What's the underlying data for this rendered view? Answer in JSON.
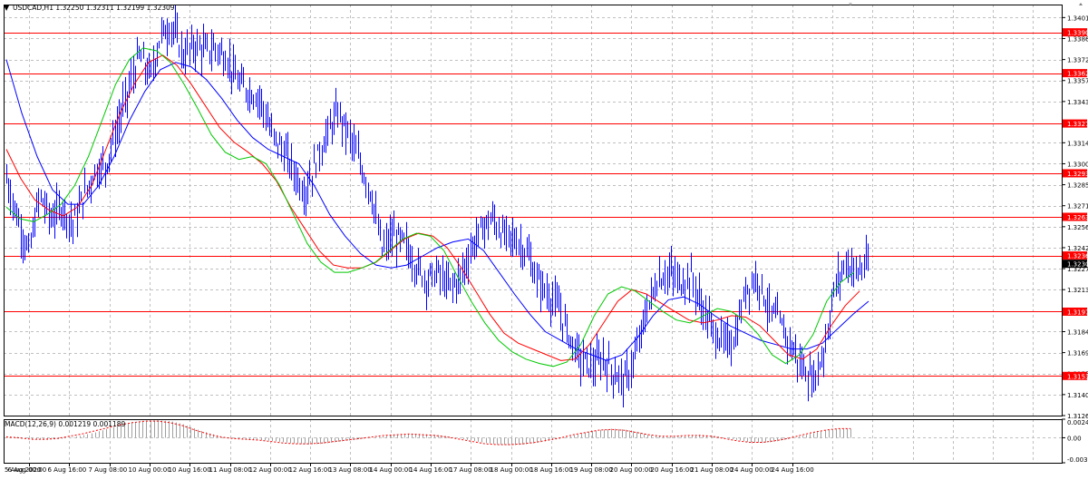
{
  "header": {
    "symbol_line": "USDCAD,H1  1.32250 1.32311 1.32199 1.32309"
  },
  "macd_label": "MACD(12,26,9) 0.001219 0.001189",
  "colors": {
    "background": "#ffffff",
    "candle": "#0000ff",
    "grid": "#c0c0c0",
    "frame": "#000000",
    "ma_fast": "#00c800",
    "ma_mid": "#ff0000",
    "ma_slow": "#0000ff",
    "hline": "#ff0000",
    "price_tag_bg": "#ff0000",
    "current_tag_bg": "#000000",
    "macd_hist": "#a0a0a0",
    "macd_signal": "#ff0000"
  },
  "chart_data": {
    "type": "line",
    "title": "USDCAD,H1",
    "price_axis_ticks": [
      "1.34010",
      "1.33865",
      "1.33720",
      "1.33575",
      "1.33430",
      "1.33145",
      "1.33000",
      "1.32855",
      "1.32710",
      "1.32565",
      "1.32420",
      "1.32275",
      "1.32130",
      "1.31840",
      "1.31695",
      "1.31550",
      "1.31405",
      "1.31260"
    ],
    "price_axis_tick_values": [
      1.3401,
      1.33865,
      1.3372,
      1.33575,
      1.3343,
      1.33145,
      1.33,
      1.32855,
      1.3271,
      1.32565,
      1.3242,
      1.32275,
      1.3213,
      1.3184,
      1.31695,
      1.3155,
      1.31405,
      1.3126
    ],
    "ylim": [
      1.3126,
      1.341
    ],
    "time_labels": [
      "5 Aug 2020",
      "6 Aug 00:00",
      "6 Aug 16:00",
      "7 Aug 08:00",
      "10 Aug 00:00",
      "10 Aug 16:00",
      "11 Aug 08:00",
      "12 Aug 00:00",
      "12 Aug 16:00",
      "13 Aug 08:00",
      "14 Aug 00:00",
      "14 Aug 16:00",
      "17 Aug 08:00",
      "18 Aug 00:00",
      "18 Aug 16:00",
      "19 Aug 08:00",
      "20 Aug 00:00",
      "20 Aug 16:00",
      "21 Aug 08:00",
      "24 Aug 00:00",
      "24 Aug 16:00"
    ],
    "horizontal_levels": [
      {
        "label": "1.33908",
        "value": 1.33908
      },
      {
        "label": "1.33626",
        "value": 1.33626
      },
      {
        "label": "1.33278",
        "value": 1.33278
      },
      {
        "label": "1.32934",
        "value": 1.32934
      },
      {
        "label": "1.32633",
        "value": 1.32633
      },
      {
        "label": "1.32366",
        "value": 1.32366
      },
      {
        "label": "1.31978",
        "value": 1.31978
      },
      {
        "label": "1.31534",
        "value": 1.31534
      }
    ],
    "current_price": {
      "label": "1.32309",
      "value": 1.32309
    },
    "price_path": [
      1.329,
      1.3262,
      1.3238,
      1.3278,
      1.3262,
      1.327,
      1.3258,
      1.3278,
      1.3295,
      1.33,
      1.3325,
      1.335,
      1.3375,
      1.336,
      1.339,
      1.3395,
      1.3375,
      1.3382,
      1.3378,
      1.338,
      1.3372,
      1.3355,
      1.335,
      1.3345,
      1.332,
      1.331,
      1.3295,
      1.328,
      1.3302,
      1.332,
      1.3335,
      1.332,
      1.33,
      1.328,
      1.324,
      1.325,
      1.3245,
      1.323,
      1.322,
      1.3225,
      1.3215,
      1.322,
      1.324,
      1.3255,
      1.3262,
      1.325,
      1.3248,
      1.324,
      1.322,
      1.321,
      1.32,
      1.318,
      1.3165,
      1.316,
      1.3165,
      1.3155,
      1.315,
      1.3168,
      1.32,
      1.322,
      1.3225,
      1.3218,
      1.3222,
      1.32,
      1.3185,
      1.3175,
      1.318,
      1.3215,
      1.3222,
      1.32,
      1.319,
      1.3175,
      1.316,
      1.315,
      1.317,
      1.3215,
      1.3232,
      1.3225,
      1.3231
    ],
    "ma_fast": [
      1.327,
      1.3262,
      1.326,
      1.3265,
      1.3272,
      1.3285,
      1.3305,
      1.333,
      1.3355,
      1.3372,
      1.338,
      1.3378,
      1.337,
      1.3355,
      1.3338,
      1.332,
      1.3308,
      1.3303,
      1.3305,
      1.33,
      1.3285,
      1.3265,
      1.3245,
      1.3232,
      1.3225,
      1.3225,
      1.3228,
      1.3232,
      1.324,
      1.3248,
      1.3252,
      1.325,
      1.324,
      1.3222,
      1.3205,
      1.319,
      1.3178,
      1.317,
      1.3165,
      1.3162,
      1.316,
      1.3163,
      1.3175,
      1.3195,
      1.321,
      1.3215,
      1.3212,
      1.3205,
      1.3198,
      1.3192,
      1.319,
      1.3195,
      1.32,
      1.3198,
      1.3192,
      1.3182,
      1.3168,
      1.3162,
      1.3168,
      1.3182,
      1.3205,
      1.3218,
      1.3225
    ],
    "ma_mid": [
      1.331,
      1.329,
      1.3275,
      1.3268,
      1.3264,
      1.327,
      1.3285,
      1.331,
      1.3335,
      1.3355,
      1.337,
      1.3375,
      1.3368,
      1.3355,
      1.334,
      1.3325,
      1.3315,
      1.3308,
      1.33,
      1.3288,
      1.327,
      1.3255,
      1.324,
      1.323,
      1.3228,
      1.3228,
      1.3232,
      1.324,
      1.3248,
      1.3252,
      1.325,
      1.3242,
      1.3228,
      1.3212,
      1.3196,
      1.3183,
      1.3176,
      1.3172,
      1.3168,
      1.3164,
      1.3165,
      1.3175,
      1.319,
      1.3205,
      1.3213,
      1.321,
      1.3204,
      1.3198,
      1.3192,
      1.319,
      1.3192,
      1.3195,
      1.3194,
      1.3188,
      1.3178,
      1.3168,
      1.3165,
      1.3172,
      1.3188,
      1.3202,
      1.3212
    ],
    "ma_slow": [
      1.3372,
      1.3335,
      1.3305,
      1.3282,
      1.3272,
      1.3272,
      1.3285,
      1.3305,
      1.333,
      1.335,
      1.3365,
      1.337,
      1.3367,
      1.3358,
      1.3345,
      1.333,
      1.3318,
      1.331,
      1.3305,
      1.33,
      1.3285,
      1.3265,
      1.325,
      1.3238,
      1.323,
      1.3228,
      1.323,
      1.3236,
      1.3242,
      1.3246,
      1.3248,
      1.324,
      1.3225,
      1.321,
      1.3196,
      1.3184,
      1.3178,
      1.3172,
      1.3168,
      1.3164,
      1.3168,
      1.318,
      1.3195,
      1.3206,
      1.3208,
      1.3203,
      1.3195,
      1.3188,
      1.3183,
      1.3178,
      1.3175,
      1.3172,
      1.3172,
      1.3176,
      1.3186,
      1.3196,
      1.3205
    ],
    "macd_axis_ticks": [
      "0.00245",
      "0.00",
      "-0.00330"
    ],
    "macd_ylim": [
      -0.0033,
      0.00245
    ],
    "macd_hist": [
      0.0002,
      0.0001,
      -0.0002,
      -0.0003,
      -0.0002,
      0.0,
      0.0003,
      0.0007,
      0.0012,
      0.0016,
      0.002,
      0.0022,
      0.0023,
      0.0022,
      0.0018,
      0.0012,
      0.0006,
      0.0002,
      -0.0001,
      -0.0002,
      -0.0003,
      -0.0004,
      -0.0006,
      -0.0008,
      -0.0009,
      -0.0008,
      -0.0006,
      -0.0004,
      -0.0002,
      0.0,
      0.0002,
      0.0004,
      0.0005,
      0.0005,
      0.0004,
      0.0002,
      -0.0001,
      -0.0004,
      -0.0007,
      -0.0009,
      -0.001,
      -0.0009,
      -0.0007,
      -0.0004,
      -0.0001,
      0.0003,
      0.0007,
      0.001,
      0.0012,
      0.0011,
      0.0008,
      0.0004,
      0.0002,
      0.0001,
      0.0002,
      0.0004,
      0.0003,
      0.0,
      -0.0003,
      -0.0006,
      -0.0007,
      -0.0005,
      -0.0002,
      0.0002,
      0.0006,
      0.001,
      0.0012,
      0.0012
    ],
    "macd_signal": [
      0.0001,
      0.0,
      -0.0002,
      -0.0002,
      -0.0001,
      0.0002,
      0.0005,
      0.0009,
      0.0013,
      0.0017,
      0.002,
      0.0022,
      0.0022,
      0.002,
      0.0016,
      0.001,
      0.0005,
      0.0001,
      -0.0001,
      -0.0002,
      -0.0003,
      -0.0005,
      -0.0007,
      -0.0008,
      -0.0008,
      -0.0007,
      -0.0005,
      -0.0003,
      -0.0001,
      0.0001,
      0.0003,
      0.0004,
      0.0005,
      0.0004,
      0.0003,
      0.0001,
      -0.0002,
      -0.0005,
      -0.0008,
      -0.0009,
      -0.0009,
      -0.0008,
      -0.0006,
      -0.0003,
      0.0,
      0.0004,
      0.0007,
      0.001,
      0.0011,
      0.001,
      0.0007,
      0.0004,
      0.0002,
      0.0002,
      0.0003,
      0.0003,
      0.0002,
      -0.0001,
      -0.0004,
      -0.0006,
      -0.0006,
      -0.0004,
      -0.0001,
      0.0003,
      0.0007,
      0.001,
      0.0012,
      0.0012
    ]
  }
}
